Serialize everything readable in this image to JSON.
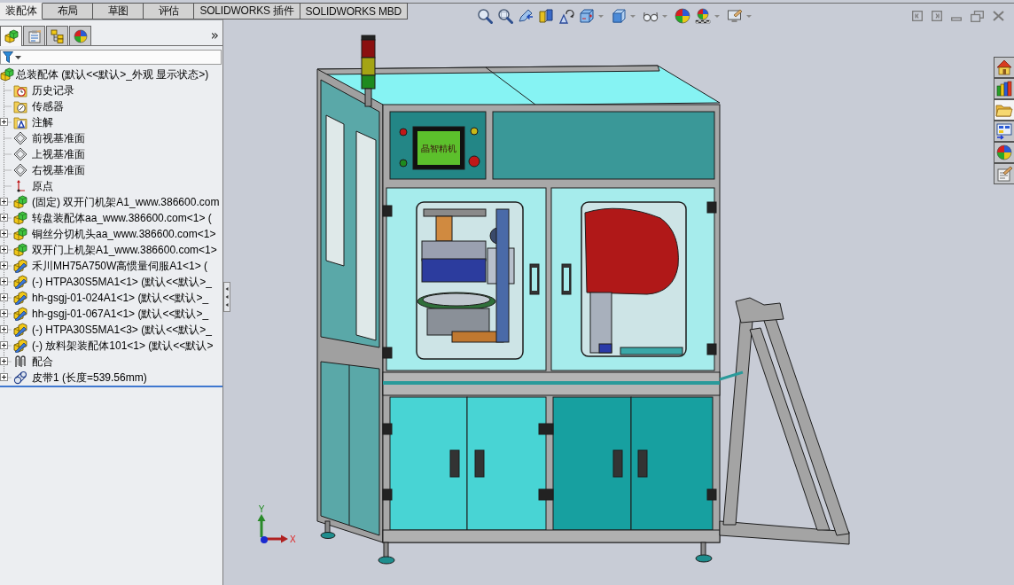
{
  "command_tabs": [
    {
      "label": "装配体",
      "selected": true
    },
    {
      "label": "布局",
      "selected": false
    },
    {
      "label": "草图",
      "selected": false
    },
    {
      "label": "评估",
      "selected": false
    },
    {
      "label": "SOLIDWORKS 插件",
      "selected": false
    },
    {
      "label": "SOLIDWORKS MBD",
      "selected": false
    }
  ],
  "heads_up_toolbar": [
    {
      "kind": "zoom-fit",
      "dropdown": false
    },
    {
      "kind": "zoom-area",
      "dropdown": false
    },
    {
      "kind": "previous-view",
      "dropdown": false
    },
    {
      "kind": "section-view",
      "dropdown": false
    },
    {
      "kind": "dynamic-annotation",
      "dropdown": false
    },
    {
      "kind": "view-orientation",
      "dropdown": true
    },
    {
      "kind": "display-style",
      "dropdown": true
    },
    {
      "kind": "hide-show",
      "dropdown": true
    },
    {
      "kind": "edit-appearance",
      "dropdown": false
    },
    {
      "kind": "apply-scene",
      "dropdown": true
    },
    {
      "kind": "view-settings",
      "dropdown": true
    }
  ],
  "feature_manager": {
    "tabs": [
      {
        "kind": "feature-tree",
        "selected": true
      },
      {
        "kind": "property-manager",
        "selected": false
      },
      {
        "kind": "configuration-manager",
        "selected": false
      },
      {
        "kind": "display-manager",
        "selected": false
      }
    ],
    "more": "»",
    "tree": {
      "kind": "assembly",
      "label": "总装配体 (默认<<默认>_外观 显示状态>)",
      "children": [
        {
          "kind": "history",
          "label": "历史记录",
          "expandable": false
        },
        {
          "kind": "sensors",
          "label": "传感器",
          "expandable": false
        },
        {
          "kind": "annotations",
          "label": "注解",
          "expandable": true
        },
        {
          "kind": "plane",
          "label": "前视基准面",
          "expandable": false
        },
        {
          "kind": "plane",
          "label": "上视基准面",
          "expandable": false
        },
        {
          "kind": "plane",
          "label": "右视基准面",
          "expandable": false
        },
        {
          "kind": "origin",
          "label": "原点",
          "expandable": false
        },
        {
          "kind": "assembly",
          "label": "(固定) 双开门机架A1_www.386600.com",
          "expandable": true
        },
        {
          "kind": "assembly",
          "label": "转盘装配体aa_www.386600.com<1> (",
          "expandable": true
        },
        {
          "kind": "assembly",
          "label": "铜丝分切机头aa_www.386600.com<1>",
          "expandable": true
        },
        {
          "kind": "assembly",
          "label": "双开门上机架A1_www.386600.com<1>",
          "expandable": true
        },
        {
          "kind": "part",
          "label": "禾川MH75A750W高惯量伺服A1<1> (",
          "expandable": true
        },
        {
          "kind": "part",
          "label": "(-) HTPA30S5MA1<1> (默认<<默认>_",
          "expandable": true
        },
        {
          "kind": "part",
          "label": "hh-gsgj-01-024A1<1> (默认<<默认>_",
          "expandable": true
        },
        {
          "kind": "part",
          "label": "hh-gsgj-01-067A1<1> (默认<<默认>_",
          "expandable": true
        },
        {
          "kind": "part",
          "label": "(-) HTPA30S5MA1<3> (默认<<默认>_",
          "expandable": true
        },
        {
          "kind": "part",
          "label": "(-) 放料架装配体101<1> (默认<<默认>",
          "expandable": true
        },
        {
          "kind": "mates",
          "label": "配合",
          "expandable": true
        },
        {
          "kind": "belt",
          "label": "皮带1 (长度=539.56mm)",
          "expandable": true
        }
      ]
    }
  },
  "task_pane": [
    {
      "kind": "home",
      "selected": false
    },
    {
      "kind": "design-library",
      "selected": false
    },
    {
      "kind": "file-explorer",
      "selected": true
    },
    {
      "kind": "view-palette",
      "selected": false
    },
    {
      "kind": "appearances",
      "selected": false
    },
    {
      "kind": "custom-properties",
      "selected": false
    }
  ],
  "graphics": {
    "screen_text": "晶智精机",
    "triad": {
      "y_label": "Y",
      "x_label": "X"
    }
  }
}
